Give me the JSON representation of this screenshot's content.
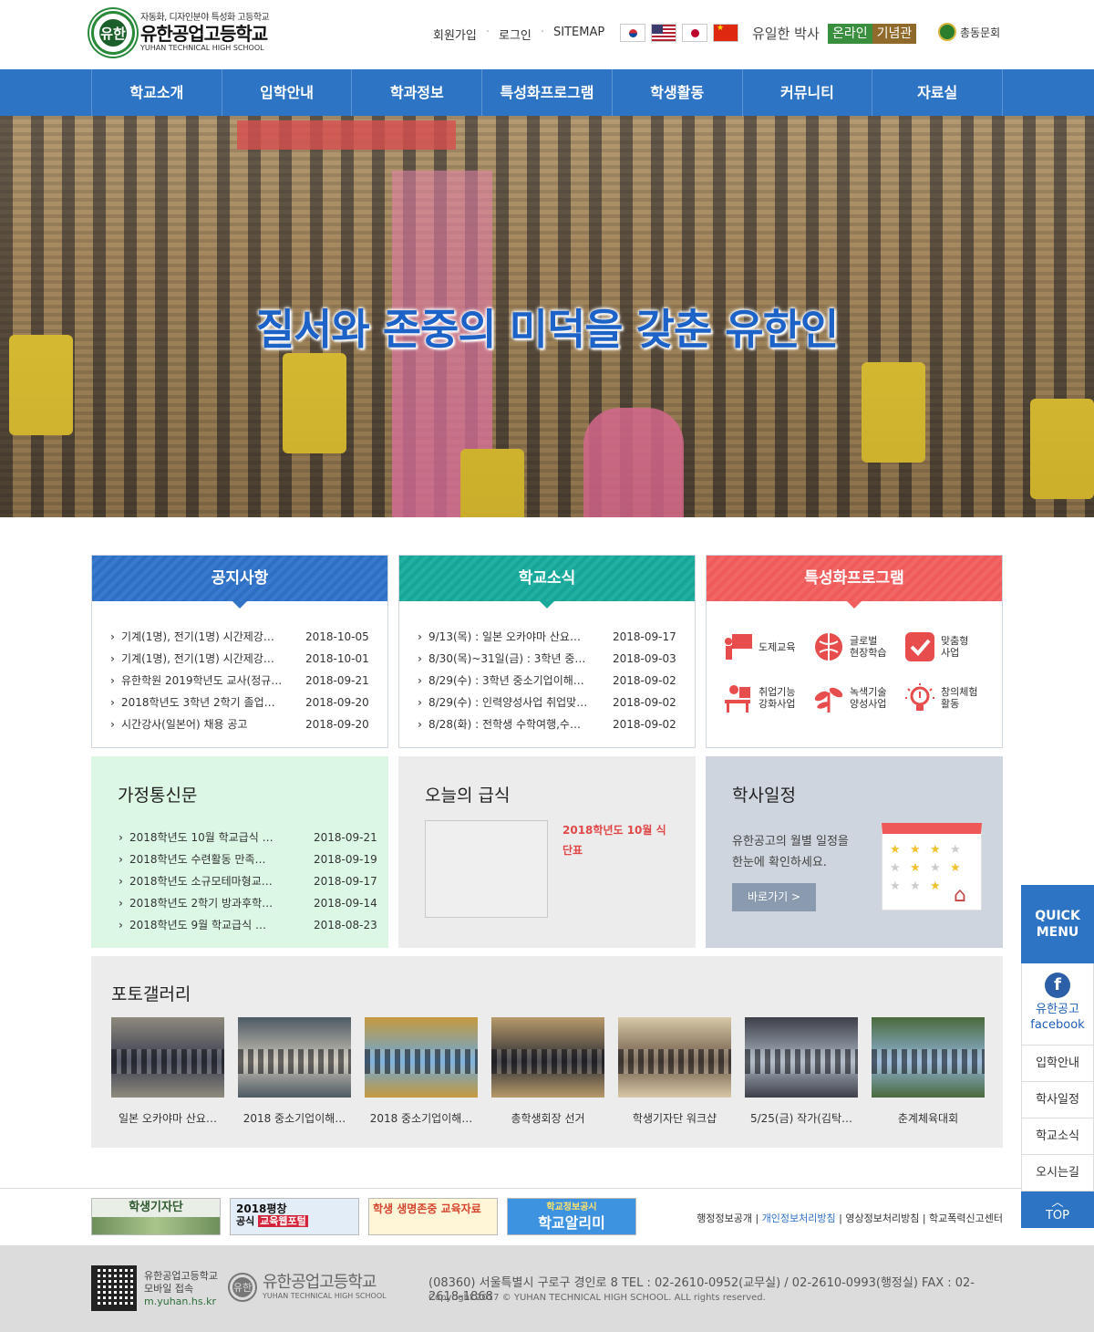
{
  "header": {
    "logo_sub": "자동화, 디자인분야 특성화 고등학교",
    "logo_name": "유한공업고등학교",
    "logo_eng": "YUHAN TECHNICAL HIGH SCHOOL",
    "logo_mark": "유한",
    "util": [
      "회원가입",
      "로그인",
      "SITEMAP"
    ],
    "dr_link": "유일한 박사",
    "online_a": "온라인",
    "online_b": "기념관",
    "chongdong": "총동문회"
  },
  "nav": [
    "학교소개",
    "입학안내",
    "학과정보",
    "특성화프로그램",
    "학생활동",
    "커뮤니티",
    "자료실"
  ],
  "hero": {
    "slogan": "질서와 존중의 미덕을 갖춘 유한인"
  },
  "notice": {
    "title": "공지사항",
    "items": [
      {
        "t": "기계(1명), 전기(1명) 시간제강…",
        "d": "2018-10-05"
      },
      {
        "t": "기계(1명), 전기(1명) 시간제강…",
        "d": "2018-10-01"
      },
      {
        "t": "유한학원 2019학년도 교사(정규…",
        "d": "2018-09-21"
      },
      {
        "t": "2018학년도 3학년 2학기 졸업…",
        "d": "2018-09-20"
      },
      {
        "t": "시간강사(일본어) 채용 공고",
        "d": "2018-09-20"
      }
    ]
  },
  "news": {
    "title": "학교소식",
    "items": [
      {
        "t": "9/13(목) : 일본 오카야마 산요…",
        "d": "2018-09-17"
      },
      {
        "t": "8/30(목)~31일(금) : 3학년 중…",
        "d": "2018-09-03"
      },
      {
        "t": "8/29(수) : 3학년 중소기업이해…",
        "d": "2018-09-02"
      },
      {
        "t": "8/29(수) : 인력양성사업 취업맞…",
        "d": "2018-09-02"
      },
      {
        "t": "8/28(화) : 전학생 수학여행,수…",
        "d": "2018-09-02"
      }
    ]
  },
  "program": {
    "title": "특성화프로그램",
    "items": [
      {
        "label1": "도제교육",
        "label2": "",
        "icon": "apprentice-icon"
      },
      {
        "label1": "글로벌",
        "label2": "현장학습",
        "icon": "globe-icon"
      },
      {
        "label1": "맞춤형",
        "label2": "사업",
        "icon": "check-icon"
      },
      {
        "label1": "취업기능",
        "label2": "강화사업",
        "icon": "desk-icon"
      },
      {
        "label1": "녹색기술",
        "label2": "양성사업",
        "icon": "leaf-icon"
      },
      {
        "label1": "창의체험",
        "label2": "활동",
        "icon": "bulb-icon"
      }
    ]
  },
  "newsletter": {
    "title": "가정통신문",
    "items": [
      {
        "t": "2018학년도 10월 학교급식 …",
        "d": "2018-09-21"
      },
      {
        "t": "2018학년도 수련활동 만족…",
        "d": "2018-09-19"
      },
      {
        "t": "2018학년도 소규모테마형교…",
        "d": "2018-09-17"
      },
      {
        "t": "2018학년도 2학기 방과후학…",
        "d": "2018-09-14"
      },
      {
        "t": "2018학년도 9월 학교급식 …",
        "d": "2018-08-23"
      }
    ]
  },
  "meal": {
    "title": "오늘의 급식",
    "text": "2018학년도 10월 식단표"
  },
  "calendar": {
    "title": "학사일정",
    "line1": "유한공고의 월별 일정을",
    "line2": "한눈에 확인하세요.",
    "button": "바로가기 >"
  },
  "gallery": {
    "title": "포토갤러리",
    "items": [
      {
        "cap": "일본 오카야마 산요…",
        "c1": "#3a3f50",
        "c2": "#8f8a7e"
      },
      {
        "cap": "2018 중소기업이해…",
        "c1": "#c9c2b4",
        "c2": "#4d5a64"
      },
      {
        "cap": "2018 중소기업이해…",
        "c1": "#6aa6d8",
        "c2": "#c69a3e"
      },
      {
        "cap": "총학생회장 선거",
        "c1": "#2e2f36",
        "c2": "#b89a6a"
      },
      {
        "cap": "학생기자단 워크샵",
        "c1": "#6d5a48",
        "c2": "#d8c8a8"
      },
      {
        "cap": "5/25(금) 작가(김탁…",
        "c1": "#a8b3c0",
        "c2": "#3d3f48"
      },
      {
        "cap": "춘계체육대회",
        "c1": "#8fb2d6",
        "c2": "#4a6a3c"
      }
    ]
  },
  "banners": [
    {
      "text": "학생기자단",
      "bg": "#e9efe6",
      "fg": "#2f5a30"
    },
    {
      "text": "2018평창 공식 교육웹포털",
      "bg": "#e3edf8",
      "fg": "#111"
    },
    {
      "text": "학생 생명존중 교육자료",
      "bg": "#fff6d8",
      "fg": "#d4452e"
    },
    {
      "text": "학교알리미",
      "bg": "#3d93e0",
      "fg": "#fff"
    }
  ],
  "banner_sub": {
    "b2_top": "2018평창",
    "b2_mid": "공식",
    "b2_red": "교육웹포털",
    "b4_top": "학교정보공시"
  },
  "policy": [
    "행정정보공개",
    "개인정보처리방침",
    "영상정보처리방침",
    "학교폭력신고센터"
  ],
  "footer": {
    "mob1": "유한공업고등학교",
    "mob2": "모바일 접속",
    "mob_url": "m.yuhan.hs.kr",
    "logo_k": "유한공업고등학교",
    "logo_e": "YUHAN TECHNICAL HIGH SCHOOL",
    "address": "(08360) 서울특별시 구로구 경인로 8   TEL : 02-2610-0952(교무실) / 02-2610-0993(행정실)   FAX : 02-2618-1868",
    "copyright": "Copyright 2017 © YUHAN TECHNICAL HIGH SCHOOL. ALL rights reserved."
  },
  "quick": {
    "title1": "QUICK",
    "title2": "MENU",
    "fb1": "유한공고",
    "fb2": "facebook",
    "items": [
      "입학안내",
      "학사일정",
      "학교소식",
      "오시는길"
    ],
    "top": "TOP"
  }
}
